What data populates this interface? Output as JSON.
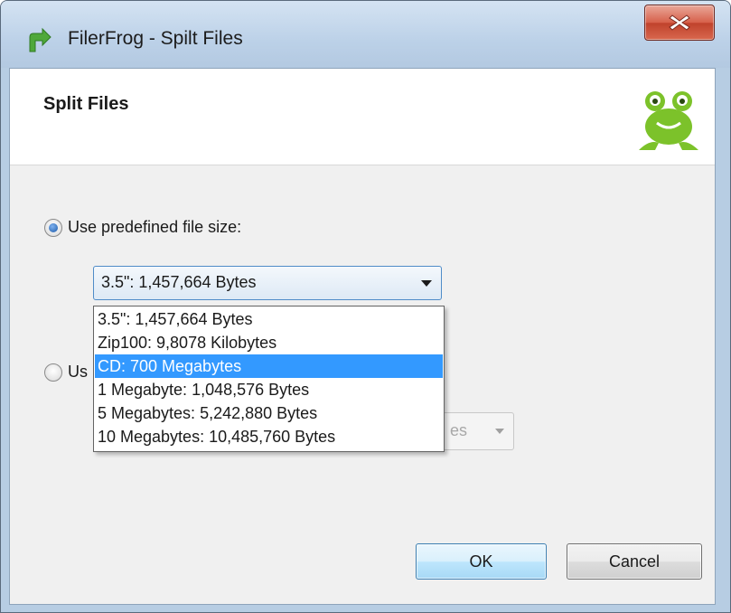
{
  "window": {
    "title": "FilerFrog - Spilt Files"
  },
  "header": {
    "title": "Split Files"
  },
  "options": {
    "predefined_label": "Use predefined file size:",
    "custom_label_visible": "Us",
    "selected_value": "3.5\": 1,457,664 Bytes",
    "sizes": [
      "3.5\": 1,457,664 Bytes",
      "Zip100: 9,8078 Kilobytes",
      "CD: 700 Megabytes",
      "1 Megabyte: 1,048,576 Bytes",
      "5 Megabytes: 5,242,880 Bytes",
      "10 Megabytes: 10,485,760 Bytes"
    ],
    "highlighted_index": 2,
    "unit_fragment": "es"
  },
  "buttons": {
    "ok": "OK",
    "cancel": "Cancel"
  },
  "colors": {
    "highlight": "#3399ff",
    "frog": "#7cc22a"
  }
}
